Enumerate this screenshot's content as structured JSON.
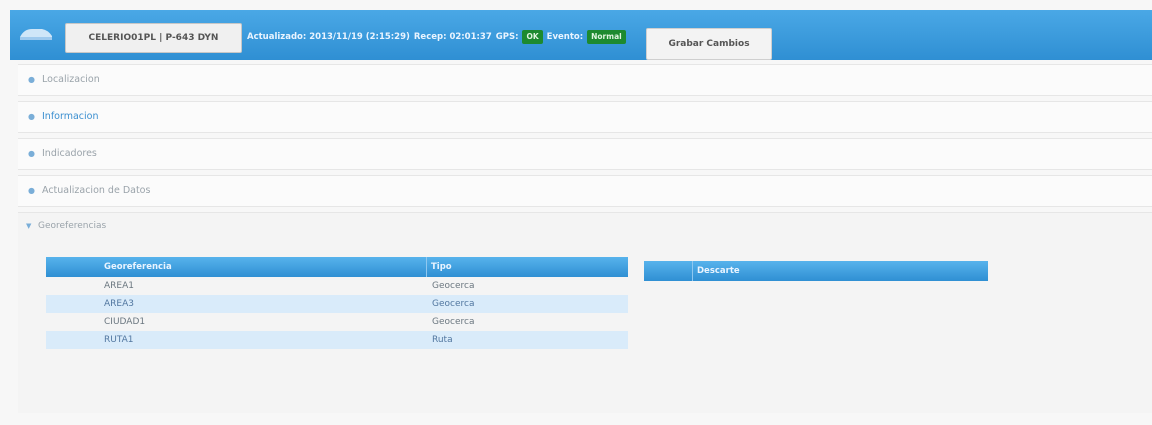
{
  "header": {
    "vehicle_label": "CELERIO01PL | P-643 DYN",
    "actualizado": "Actualizado: 2013/11/19 (2:15:29)",
    "recep": "Recep: 02:01:37",
    "gps_label": "GPS:",
    "gps_badge": "OK",
    "evento_label": "Evento:",
    "evento_badge": "Normal",
    "save_label": "Grabar Cambios",
    "colors": {
      "header": "#2f8fd3",
      "badge": "#1d8a2f"
    }
  },
  "panels": [
    {
      "label": "Localizacion"
    },
    {
      "label": "Informacion"
    },
    {
      "label": "Indicadores"
    },
    {
      "label": "Actualizacion de Datos"
    }
  ],
  "geo": {
    "title": "Georeferencias",
    "table": {
      "headers": [
        "Georeferencia",
        "Tipo"
      ],
      "rows": [
        [
          "AREA1",
          "Geocerca"
        ],
        [
          "AREA3",
          "Geocerca"
        ],
        [
          "CIUDAD1",
          "Geocerca"
        ],
        [
          "RUTA1",
          "Ruta"
        ]
      ]
    },
    "table2_header": "Descarte"
  }
}
